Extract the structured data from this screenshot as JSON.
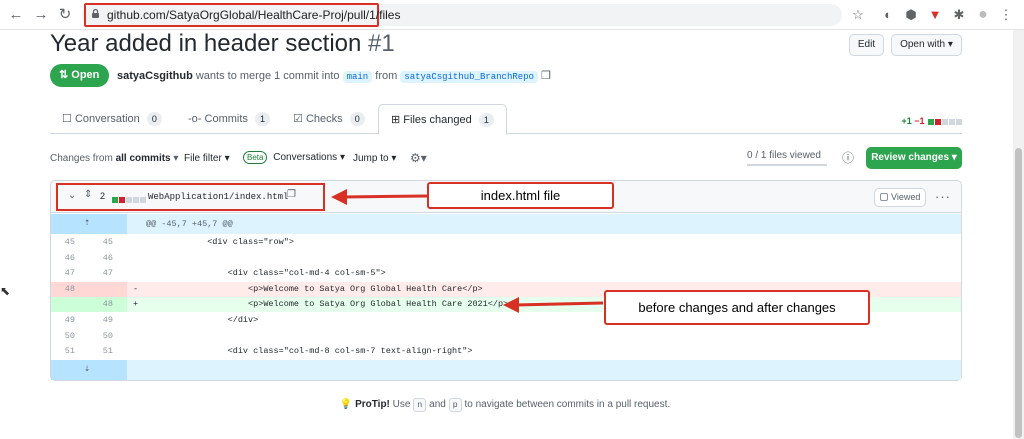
{
  "browser": {
    "url": "github.com/SatyaOrgGlobal/HealthCare-Proj/pull/1/files"
  },
  "pr": {
    "title": "Year added in header section",
    "number": "#1",
    "edit_label": "Edit",
    "open_with_label": "Open with",
    "state_label": "Open",
    "author": "satyaCsgithub",
    "merge_text": "wants to merge 1 commit into",
    "base_branch": "main",
    "from_text": "from",
    "head_branch": "satyaCsgithub_BranchRepo"
  },
  "tabs": [
    {
      "label": "Conversation",
      "count": "0"
    },
    {
      "label": "Commits",
      "count": "1"
    },
    {
      "label": "Checks",
      "count": "0"
    },
    {
      "label": "Files changed",
      "count": "1"
    }
  ],
  "diffstat": {
    "additions": "+1",
    "deletions": "−1"
  },
  "toolbar": {
    "changes_from_prefix": "Changes from",
    "changes_from_value": "all commits",
    "file_filter": "File filter",
    "beta": "Beta",
    "conversations": "Conversations",
    "jump_to": "Jump to",
    "files_viewed": "0 / 1 files viewed",
    "files_viewed_fraction": 0,
    "review_changes": "Review changes"
  },
  "file": {
    "changes_count": "2",
    "path": "WebApplication1/index.html",
    "viewed_label": "Viewed"
  },
  "diff": {
    "hunk_header": "@@ -45,7 +45,7 @@",
    "rows": [
      {
        "old": "45",
        "new": "45",
        "marker": "",
        "code": "            <div class=\"row\">"
      },
      {
        "old": "46",
        "new": "46",
        "marker": "",
        "code": ""
      },
      {
        "old": "47",
        "new": "47",
        "marker": "",
        "code": "                <div class=\"col-md-4 col-sm-5\">"
      },
      {
        "old": "48",
        "new": "",
        "marker": "-",
        "code": "                    <p>Welcome to Satya Org Global Health Care</p>"
      },
      {
        "old": "",
        "new": "48",
        "marker": "+",
        "code": "                    <p>Welcome to Satya Org Global Health Care 2021</p>"
      },
      {
        "old": "49",
        "new": "49",
        "marker": "",
        "code": "                </div>"
      },
      {
        "old": "50",
        "new": "50",
        "marker": "",
        "code": ""
      },
      {
        "old": "51",
        "new": "51",
        "marker": "",
        "code": "                <div class=\"col-md-8 col-sm-7 text-align-right\">"
      }
    ]
  },
  "callouts": {
    "file_label": "index.html file",
    "changes_label": "before changes and after changes"
  },
  "protip": {
    "label": "ProTip!",
    "text_1": "Use",
    "key_n": "n",
    "text_2": "and",
    "key_p": "p",
    "text_3": "to navigate between commits in a pull request."
  },
  "colors": {
    "open_green": "#2da44e",
    "annotation_red": "#d93025",
    "link_blue": "#0969da"
  }
}
